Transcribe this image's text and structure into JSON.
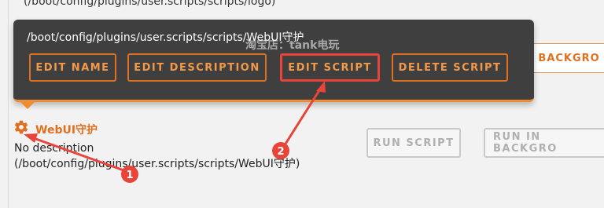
{
  "page": {
    "top_path": "(/boot/config/plugins/user.scripts/scripts/logo)",
    "background_button_label": "N BACKGRO"
  },
  "tooltip": {
    "path": "/boot/config/plugins/user.scripts/scripts/WebUI守护",
    "watermark": "淘宝店：tank电玩",
    "buttons": [
      "EDIT NAME",
      "EDIT DESCRIPTION",
      "EDIT SCRIPT",
      "DELETE SCRIPT"
    ]
  },
  "script": {
    "icon": "gear-icon",
    "title": "WebUI守护",
    "description": "No description",
    "path": "(/boot/config/plugins/user.scripts/scripts/WebUI守护)",
    "buttons": [
      "RUN SCRIPT",
      "RUN IN BACKGRO"
    ]
  },
  "annotations": {
    "markers": [
      "1",
      "2"
    ]
  },
  "colors": {
    "accent": "#e0701f",
    "tooltip_bg": "#3f3f3f",
    "annotation_red": "#e8443a"
  }
}
